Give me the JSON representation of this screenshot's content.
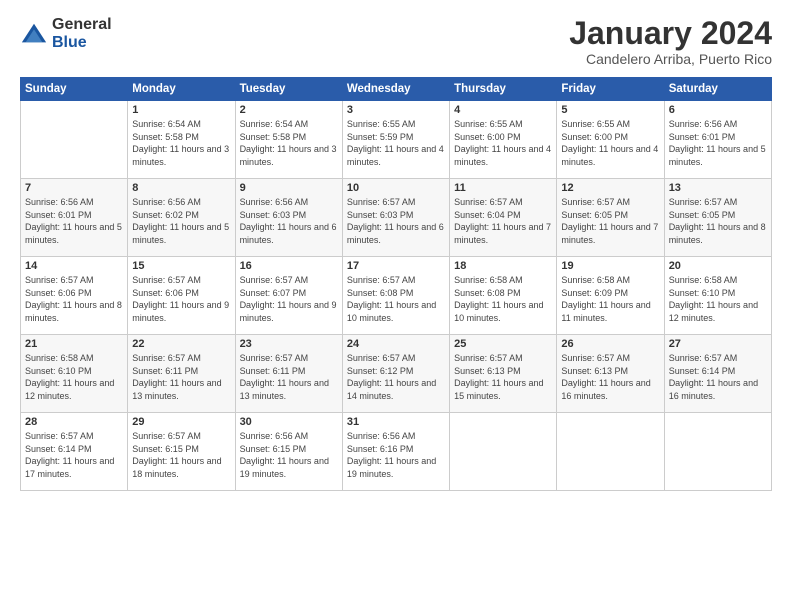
{
  "logo": {
    "general": "General",
    "blue": "Blue"
  },
  "header": {
    "month": "January 2024",
    "location": "Candelero Arriba, Puerto Rico"
  },
  "weekdays": [
    "Sunday",
    "Monday",
    "Tuesday",
    "Wednesday",
    "Thursday",
    "Friday",
    "Saturday"
  ],
  "weeks": [
    [
      {
        "day": "",
        "sunrise": "",
        "sunset": "",
        "daylight": ""
      },
      {
        "day": "1",
        "sunrise": "Sunrise: 6:54 AM",
        "sunset": "Sunset: 5:58 PM",
        "daylight": "Daylight: 11 hours and 3 minutes."
      },
      {
        "day": "2",
        "sunrise": "Sunrise: 6:54 AM",
        "sunset": "Sunset: 5:58 PM",
        "daylight": "Daylight: 11 hours and 3 minutes."
      },
      {
        "day": "3",
        "sunrise": "Sunrise: 6:55 AM",
        "sunset": "Sunset: 5:59 PM",
        "daylight": "Daylight: 11 hours and 4 minutes."
      },
      {
        "day": "4",
        "sunrise": "Sunrise: 6:55 AM",
        "sunset": "Sunset: 6:00 PM",
        "daylight": "Daylight: 11 hours and 4 minutes."
      },
      {
        "day": "5",
        "sunrise": "Sunrise: 6:55 AM",
        "sunset": "Sunset: 6:00 PM",
        "daylight": "Daylight: 11 hours and 4 minutes."
      },
      {
        "day": "6",
        "sunrise": "Sunrise: 6:56 AM",
        "sunset": "Sunset: 6:01 PM",
        "daylight": "Daylight: 11 hours and 5 minutes."
      }
    ],
    [
      {
        "day": "7",
        "sunrise": "Sunrise: 6:56 AM",
        "sunset": "Sunset: 6:01 PM",
        "daylight": "Daylight: 11 hours and 5 minutes."
      },
      {
        "day": "8",
        "sunrise": "Sunrise: 6:56 AM",
        "sunset": "Sunset: 6:02 PM",
        "daylight": "Daylight: 11 hours and 5 minutes."
      },
      {
        "day": "9",
        "sunrise": "Sunrise: 6:56 AM",
        "sunset": "Sunset: 6:03 PM",
        "daylight": "Daylight: 11 hours and 6 minutes."
      },
      {
        "day": "10",
        "sunrise": "Sunrise: 6:57 AM",
        "sunset": "Sunset: 6:03 PM",
        "daylight": "Daylight: 11 hours and 6 minutes."
      },
      {
        "day": "11",
        "sunrise": "Sunrise: 6:57 AM",
        "sunset": "Sunset: 6:04 PM",
        "daylight": "Daylight: 11 hours and 7 minutes."
      },
      {
        "day": "12",
        "sunrise": "Sunrise: 6:57 AM",
        "sunset": "Sunset: 6:05 PM",
        "daylight": "Daylight: 11 hours and 7 minutes."
      },
      {
        "day": "13",
        "sunrise": "Sunrise: 6:57 AM",
        "sunset": "Sunset: 6:05 PM",
        "daylight": "Daylight: 11 hours and 8 minutes."
      }
    ],
    [
      {
        "day": "14",
        "sunrise": "Sunrise: 6:57 AM",
        "sunset": "Sunset: 6:06 PM",
        "daylight": "Daylight: 11 hours and 8 minutes."
      },
      {
        "day": "15",
        "sunrise": "Sunrise: 6:57 AM",
        "sunset": "Sunset: 6:06 PM",
        "daylight": "Daylight: 11 hours and 9 minutes."
      },
      {
        "day": "16",
        "sunrise": "Sunrise: 6:57 AM",
        "sunset": "Sunset: 6:07 PM",
        "daylight": "Daylight: 11 hours and 9 minutes."
      },
      {
        "day": "17",
        "sunrise": "Sunrise: 6:57 AM",
        "sunset": "Sunset: 6:08 PM",
        "daylight": "Daylight: 11 hours and 10 minutes."
      },
      {
        "day": "18",
        "sunrise": "Sunrise: 6:58 AM",
        "sunset": "Sunset: 6:08 PM",
        "daylight": "Daylight: 11 hours and 10 minutes."
      },
      {
        "day": "19",
        "sunrise": "Sunrise: 6:58 AM",
        "sunset": "Sunset: 6:09 PM",
        "daylight": "Daylight: 11 hours and 11 minutes."
      },
      {
        "day": "20",
        "sunrise": "Sunrise: 6:58 AM",
        "sunset": "Sunset: 6:10 PM",
        "daylight": "Daylight: 11 hours and 12 minutes."
      }
    ],
    [
      {
        "day": "21",
        "sunrise": "Sunrise: 6:58 AM",
        "sunset": "Sunset: 6:10 PM",
        "daylight": "Daylight: 11 hours and 12 minutes."
      },
      {
        "day": "22",
        "sunrise": "Sunrise: 6:57 AM",
        "sunset": "Sunset: 6:11 PM",
        "daylight": "Daylight: 11 hours and 13 minutes."
      },
      {
        "day": "23",
        "sunrise": "Sunrise: 6:57 AM",
        "sunset": "Sunset: 6:11 PM",
        "daylight": "Daylight: 11 hours and 13 minutes."
      },
      {
        "day": "24",
        "sunrise": "Sunrise: 6:57 AM",
        "sunset": "Sunset: 6:12 PM",
        "daylight": "Daylight: 11 hours and 14 minutes."
      },
      {
        "day": "25",
        "sunrise": "Sunrise: 6:57 AM",
        "sunset": "Sunset: 6:13 PM",
        "daylight": "Daylight: 11 hours and 15 minutes."
      },
      {
        "day": "26",
        "sunrise": "Sunrise: 6:57 AM",
        "sunset": "Sunset: 6:13 PM",
        "daylight": "Daylight: 11 hours and 16 minutes."
      },
      {
        "day": "27",
        "sunrise": "Sunrise: 6:57 AM",
        "sunset": "Sunset: 6:14 PM",
        "daylight": "Daylight: 11 hours and 16 minutes."
      }
    ],
    [
      {
        "day": "28",
        "sunrise": "Sunrise: 6:57 AM",
        "sunset": "Sunset: 6:14 PM",
        "daylight": "Daylight: 11 hours and 17 minutes."
      },
      {
        "day": "29",
        "sunrise": "Sunrise: 6:57 AM",
        "sunset": "Sunset: 6:15 PM",
        "daylight": "Daylight: 11 hours and 18 minutes."
      },
      {
        "day": "30",
        "sunrise": "Sunrise: 6:56 AM",
        "sunset": "Sunset: 6:15 PM",
        "daylight": "Daylight: 11 hours and 19 minutes."
      },
      {
        "day": "31",
        "sunrise": "Sunrise: 6:56 AM",
        "sunset": "Sunset: 6:16 PM",
        "daylight": "Daylight: 11 hours and 19 minutes."
      },
      {
        "day": "",
        "sunrise": "",
        "sunset": "",
        "daylight": ""
      },
      {
        "day": "",
        "sunrise": "",
        "sunset": "",
        "daylight": ""
      },
      {
        "day": "",
        "sunrise": "",
        "sunset": "",
        "daylight": ""
      }
    ]
  ]
}
